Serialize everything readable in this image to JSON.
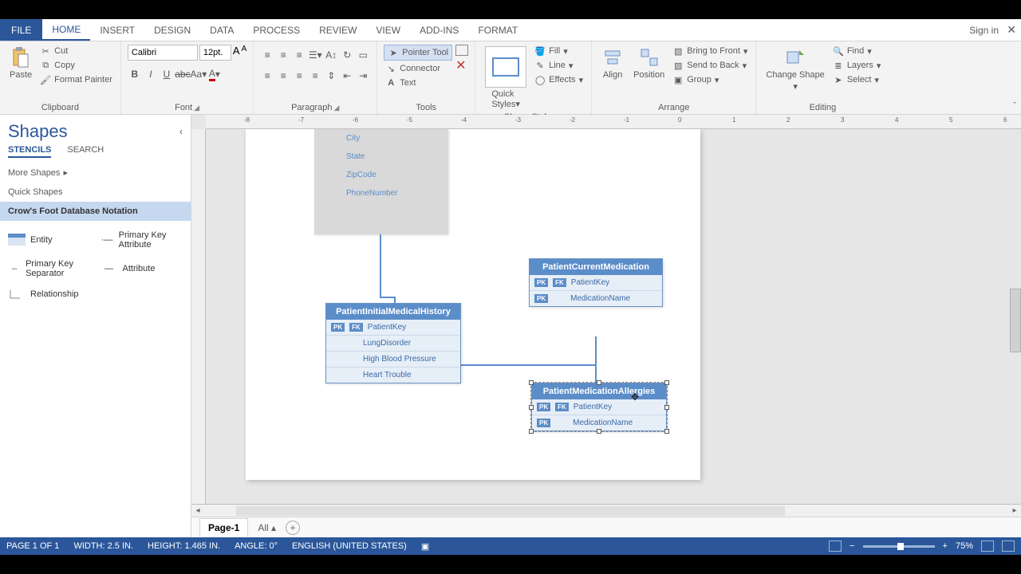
{
  "tabs": {
    "file": "FILE",
    "list": [
      "HOME",
      "INSERT",
      "DESIGN",
      "DATA",
      "PROCESS",
      "REVIEW",
      "VIEW",
      "ADD-INS",
      "FORMAT"
    ],
    "active": "HOME",
    "signin": "Sign in"
  },
  "ribbon": {
    "clipboard": {
      "label": "Clipboard",
      "paste": "Paste",
      "cut": "Cut",
      "copy": "Copy",
      "painter": "Format Painter"
    },
    "font": {
      "label": "Font",
      "name": "Calibri",
      "size": "12pt."
    },
    "paragraph": {
      "label": "Paragraph"
    },
    "tools": {
      "label": "Tools",
      "pointer": "Pointer Tool",
      "connector": "Connector",
      "text": "Text"
    },
    "shapestyles": {
      "label": "Shape Styles",
      "fill": "Fill",
      "line": "Line",
      "effects": "Effects"
    },
    "arrange": {
      "label": "Arrange",
      "align": "Align",
      "position": "Position",
      "front": "Bring to Front",
      "back": "Send to Back",
      "group": "Group"
    },
    "editing": {
      "label": "Editing",
      "change": "Change Shape",
      "find": "Find",
      "layers": "Layers",
      "select": "Select"
    }
  },
  "shapesPane": {
    "title": "Shapes",
    "tabStencils": "STENCILS",
    "tabSearch": "SEARCH",
    "more": "More Shapes",
    "quick": "Quick Shapes",
    "stencil": "Crow's Foot Database Notation",
    "items": [
      "Entity",
      "Primary Key Attribute",
      "Primary Key Separator",
      "Attribute",
      "Relationship"
    ]
  },
  "canvas": {
    "hruler": [
      "-8",
      "-7",
      "-6",
      "-5",
      "-4",
      "-3",
      "-2",
      "-1",
      "0",
      "1",
      "2",
      "3",
      "4",
      "5",
      "6"
    ],
    "entities": {
      "partial": {
        "rows": [
          "City",
          "State",
          "ZipCode",
          "PhoneNumber"
        ]
      },
      "history": {
        "title": "PatientInitialMedicalHistory",
        "pk": "PatientKey",
        "attrs": [
          "LungDisorder",
          "High Blood Pressure",
          "Heart Trouble"
        ]
      },
      "current": {
        "title": "PatientCurrentMedication",
        "pk": "PatientKey",
        "attrs": [
          "MedicationName"
        ]
      },
      "allergies": {
        "title": "PatientMedicationAllergies",
        "pk": "PatientKey",
        "attrs": [
          "MedicationName"
        ]
      }
    }
  },
  "pagetabs": {
    "page": "Page-1",
    "all": "All"
  },
  "status": {
    "page": "PAGE 1 OF 1",
    "width": "WIDTH: 2.5 IN.",
    "height": "HEIGHT: 1.465 IN.",
    "angle": "ANGLE: 0°",
    "lang": "ENGLISH (UNITED STATES)",
    "zoom": "75%"
  }
}
